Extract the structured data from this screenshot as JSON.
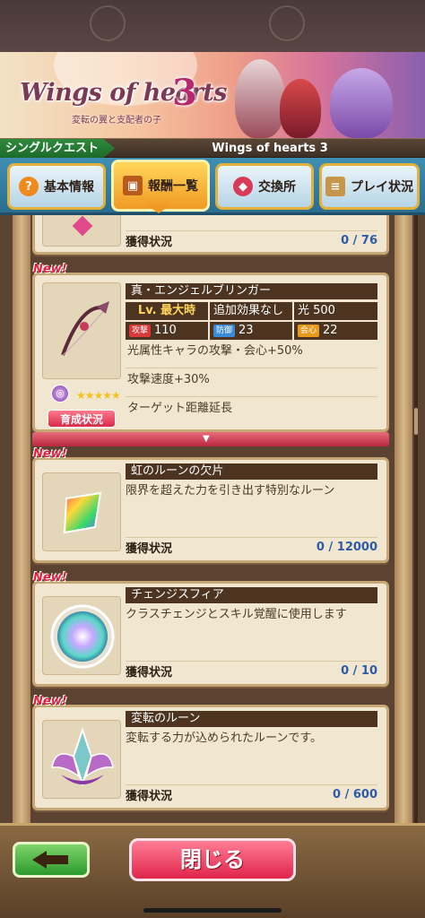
{
  "banner": {
    "logo_text": "Wings of hearts",
    "logo_number": "3",
    "subtitle": "変転の翼と支配者の子"
  },
  "title_bar": {
    "quest_type": "シングルクエスト",
    "event_title": "Wings of hearts 3"
  },
  "tabs": [
    {
      "label": "基本情報",
      "icon": "question-icon",
      "active": false
    },
    {
      "label": "報酬一覧",
      "icon": "treasure-chest-icon",
      "active": true
    },
    {
      "label": "交換所",
      "icon": "exchange-icon",
      "active": false
    },
    {
      "label": "プレイ状況",
      "icon": "scroll-icon",
      "active": false
    }
  ],
  "items": [
    {
      "partial": true,
      "acquire_label": "獲得状況",
      "acquire_value": "0 / 76"
    },
    {
      "new_label": "New!",
      "name": "真・エンジェルブリンガー",
      "level_label": "Lv. 最大時",
      "extra_effect": "追加効果なし",
      "element_stat": "光 500",
      "attack_label": "攻撃",
      "attack_value": "110",
      "defense_label": "防御",
      "defense_value": "23",
      "crit_label": "会心",
      "crit_value": "22",
      "effects": [
        "光属性キャラの攻撃・会心+50%",
        "攻撃速度+30%",
        "ターゲット距離延長"
      ],
      "stars": "★★★★★",
      "train_button": "育成状況"
    },
    {
      "new_label": "New!",
      "name": "虹のルーンの欠片",
      "description": "限界を超えた力を引き出す特別なルーン",
      "acquire_label": "獲得状況",
      "acquire_value": "0 / 12000"
    },
    {
      "new_label": "New!",
      "name": "チェンジスフィア",
      "description": "クラスチェンジとスキル覚醒に使用します",
      "acquire_label": "獲得状況",
      "acquire_value": "0 / 10"
    },
    {
      "new_label": "New!",
      "name": "変転のルーン",
      "description": "変転する力が込められたルーンです。",
      "acquire_label": "獲得状況",
      "acquire_value": "0 / 600"
    }
  ],
  "footer": {
    "back_icon": "arrow-left-icon",
    "close_label": "閉じる"
  },
  "colors": {
    "name_bar": "#4c3421",
    "acquire_value": "#2e5aa8",
    "new_tag": "#e0203a",
    "close_button": "#e0244a",
    "back_button": "#2c9a2e"
  }
}
